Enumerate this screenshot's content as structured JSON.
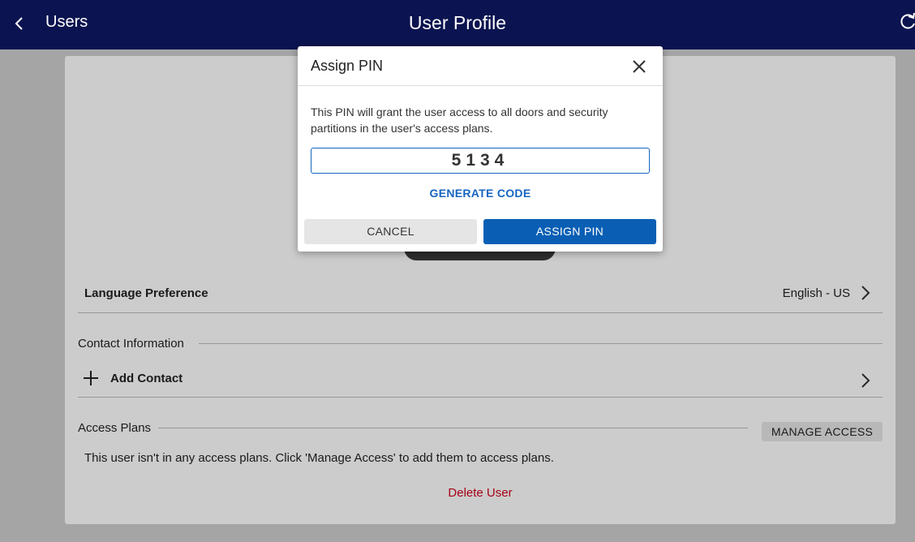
{
  "header": {
    "back_label": "Users",
    "title": "User Profile",
    "icons": [
      "chevron-left-icon",
      "refresh-icon"
    ],
    "background": "#0b1450"
  },
  "profile": {
    "language": {
      "label": "Language Preference",
      "value": "English - US"
    },
    "contact": {
      "section_title": "Contact Information",
      "add_label": "Add Contact"
    },
    "access_plans": {
      "section_title": "Access Plans",
      "manage_label": "MANAGE ACCESS",
      "empty_message": "This user isn't in any access plans. Click 'Manage Access' to add them to access plans."
    },
    "delete_label": "Delete User"
  },
  "dialog": {
    "title": "Assign PIN",
    "description": "This PIN will grant the user access to all doors and security partitions in the user's access plans.",
    "pin_value": "5134",
    "generate_label": "GENERATE CODE",
    "cancel_label": "CANCEL",
    "assign_label": "ASSIGN PIN",
    "accent": "#0a5fb4"
  },
  "colors": {
    "danger": "#d0021b",
    "link": "#1565c0"
  }
}
